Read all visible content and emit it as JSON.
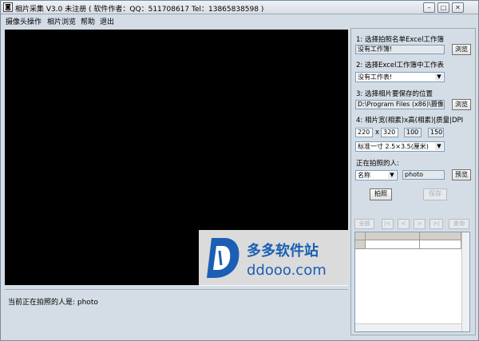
{
  "window": {
    "title": "相片采集 V3.0 未注册 ( 软件作者：QQ：511708617 Tel：13865838598 )",
    "minimize_glyph": "–",
    "maximize_glyph": "□",
    "close_glyph": "✕"
  },
  "menu": [
    "摄像头操作",
    "相片浏览",
    "帮助",
    "退出"
  ],
  "panel": {
    "step1_label": "1: 选择拍照名单Excel工作簿",
    "step1_value": "没有工作簿!",
    "browse_label": "浏览",
    "step2_label": "2: 选择Excel工作簿中工作表",
    "step2_value": "没有工作表!",
    "step3_label": "3: 选择相片要保存的位置",
    "step3_value": "D:\\Program Files (x86)\\摄像",
    "step4_label": "4: 相片宽(相素)x高(相素)|质量|DPI",
    "width_value": "220",
    "times": "x",
    "height_value": "320",
    "quality_value": "100",
    "dpi_value": "150",
    "size_preset": "标准一寸 2.5×3.5(厘米)",
    "current_person_label": "正在拍照的人:",
    "field_select": "名称",
    "person_value": "photo",
    "preview_label": "预览",
    "shoot_label": "拍照",
    "save_label": "保存",
    "nav_all": "全部",
    "nav_first": "|<",
    "nav_prev": "<",
    "nav_next": ">",
    "nav_last": ">|",
    "nav_query": "查询"
  },
  "status": {
    "text": "当前正在拍照的人是: photo"
  },
  "watermark": {
    "cn": "多多软件站",
    "en": "ddooo.com"
  },
  "colors": {
    "accent": "#1a5fb4",
    "video_bg": "#000000"
  }
}
